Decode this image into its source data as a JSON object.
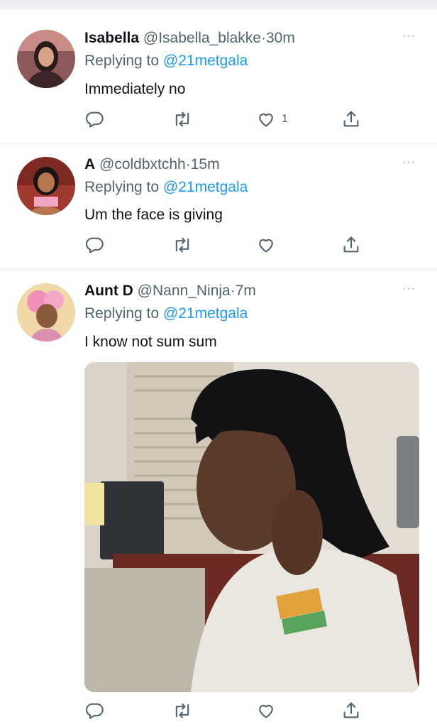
{
  "tweets": [
    {
      "name": "Isabella",
      "handle": "@Isabella_blakke",
      "separator": "·",
      "time": "30m",
      "replying_prefix": "Replying to",
      "replying_to": "@21metgala",
      "text": "Immediately no",
      "like_count": "1"
    },
    {
      "name": "A",
      "handle": "@coldbxtchh",
      "separator": "·",
      "time": "15m",
      "replying_prefix": "Replying to",
      "replying_to": "@21metgala",
      "text": "Um the face is giving",
      "like_count": ""
    },
    {
      "name": "Aunt D",
      "handle": "@Nann_Ninja",
      "separator": "·",
      "time": "7m",
      "replying_prefix": "Replying to",
      "replying_to": "@21metgala",
      "text": "I know not sum sum",
      "like_count": ""
    }
  ],
  "more_glyph": "···",
  "icons": [
    "reply-icon",
    "retweet-icon",
    "like-icon",
    "share-icon",
    "more-icon"
  ],
  "colors": {
    "link": "#1d9bf0",
    "secondary": "#536471",
    "divider": "#e6ecf0",
    "text": "#0f1419"
  }
}
